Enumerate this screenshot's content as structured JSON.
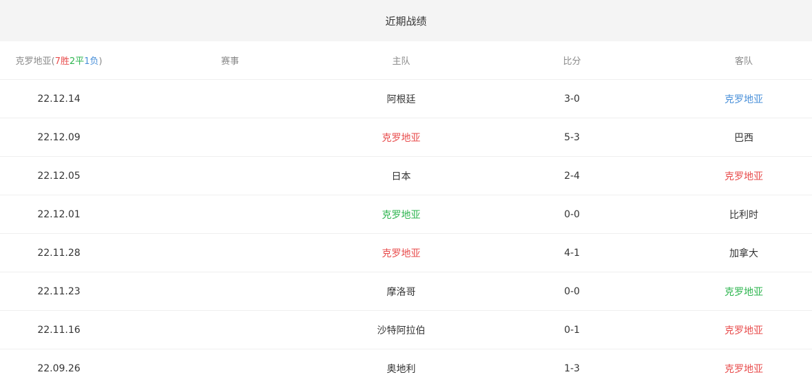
{
  "header": {
    "title": "近期战绩"
  },
  "columns": {
    "team": "克罗地亚",
    "record_open": "(",
    "wins": "7胜",
    "draws": "2平",
    "losses": "1负",
    "record_close": ")",
    "competition": "赛事",
    "home": "主队",
    "score": "比分",
    "away": "客队"
  },
  "colors": {
    "win": "#e84c4c",
    "draw": "#2db54f",
    "loss": "#4a90d9",
    "text": "#333333",
    "muted": "#8a8a8a",
    "header_bg": "#f4f4f4"
  },
  "rows": [
    {
      "date": "22.12.14",
      "competition": "",
      "home": "阿根廷",
      "score": "3-0",
      "away": "克罗地亚",
      "highlight": "away",
      "result": "loss"
    },
    {
      "date": "22.12.09",
      "competition": "",
      "home": "克罗地亚",
      "score": "5-3",
      "away": "巴西",
      "highlight": "home",
      "result": "win"
    },
    {
      "date": "22.12.05",
      "competition": "",
      "home": "日本",
      "score": "2-4",
      "away": "克罗地亚",
      "highlight": "away",
      "result": "win"
    },
    {
      "date": "22.12.01",
      "competition": "",
      "home": "克罗地亚",
      "score": "0-0",
      "away": "比利时",
      "highlight": "home",
      "result": "draw"
    },
    {
      "date": "22.11.28",
      "competition": "",
      "home": "克罗地亚",
      "score": "4-1",
      "away": "加拿大",
      "highlight": "home",
      "result": "win"
    },
    {
      "date": "22.11.23",
      "competition": "",
      "home": "摩洛哥",
      "score": "0-0",
      "away": "克罗地亚",
      "highlight": "away",
      "result": "draw"
    },
    {
      "date": "22.11.16",
      "competition": "",
      "home": "沙特阿拉伯",
      "score": "0-1",
      "away": "克罗地亚",
      "highlight": "away",
      "result": "win"
    },
    {
      "date": "22.09.26",
      "competition": "",
      "home": "奥地利",
      "score": "1-3",
      "away": "克罗地亚",
      "highlight": "away",
      "result": "win"
    }
  ]
}
